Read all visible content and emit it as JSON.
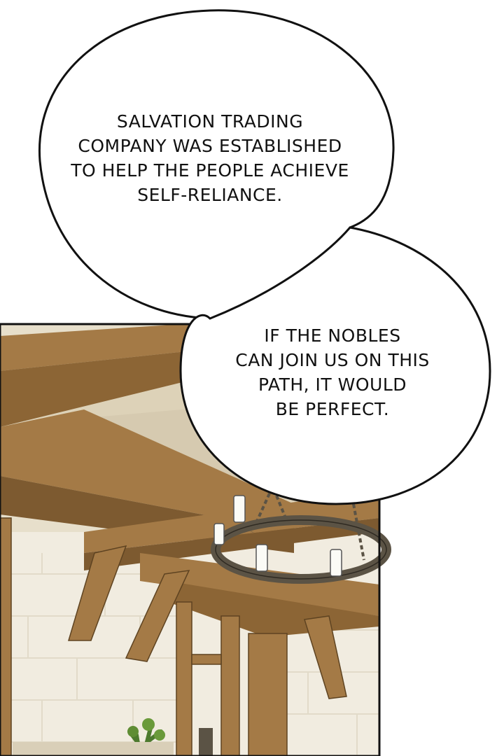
{
  "speech_bubbles": [
    {
      "lines": [
        "SALVATION TRADING",
        "COMPANY WAS ESTABLISHED",
        "TO HELP THE PEOPLE ACHIEVE",
        "SELF-RELIANCE."
      ]
    },
    {
      "lines": [
        "IF THE NOBLES",
        "CAN JOIN US ON THIS",
        "PATH, IT WOULD",
        "BE PERFECT."
      ]
    }
  ],
  "colors": {
    "bubble_fill": "#ffffff",
    "bubble_outline": "#111111",
    "wood_beam": "#a47a46",
    "wood_shadow": "#7d5a30",
    "ceiling_plaster": "#ddd2b8",
    "wall_plaster": "#f1ece0",
    "iron": "#5b5345",
    "candle": "#fbfbf6"
  }
}
